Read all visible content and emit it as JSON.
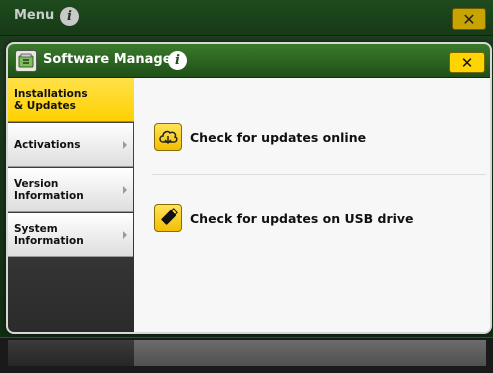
{
  "outer": {
    "title": "Menu",
    "info_glyph": "i",
    "close_glyph": "✕"
  },
  "modal": {
    "title": "Software Manager",
    "info_glyph": "i",
    "close_glyph": "✕",
    "app_icon": "software-manager-icon"
  },
  "sidebar": {
    "items": [
      {
        "label": "Installations & Updates",
        "active": true
      },
      {
        "label": "Activations",
        "active": false
      },
      {
        "label": "Version Information",
        "active": false
      },
      {
        "label": "System Information",
        "active": false
      }
    ]
  },
  "content": {
    "options": [
      {
        "label": "Check for updates online",
        "icon": "cloud-download-icon"
      },
      {
        "label": "Check for updates on USB drive",
        "icon": "usb-drive-icon"
      }
    ]
  },
  "colors": {
    "accent_yellow": "#ffd400",
    "header_green": "#2d6a22"
  }
}
